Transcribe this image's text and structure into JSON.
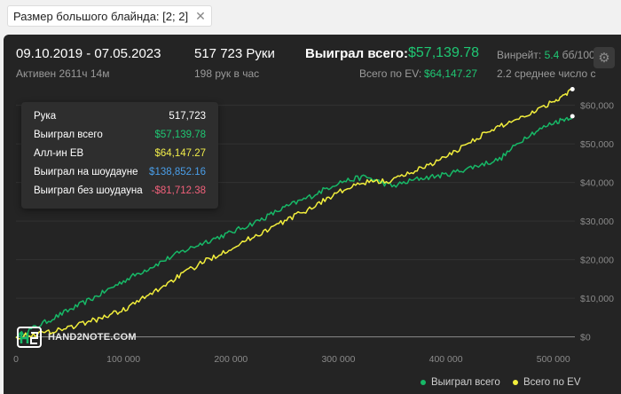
{
  "filter": {
    "label": "Размер большого блайнда: [2; 2]",
    "close_glyph": "✕"
  },
  "header": {
    "date_range": "09.10.2019 - 07.05.2023",
    "active": "Активен 2611ч 14м",
    "hands": "517 723 Руки",
    "hands_per_hour": "198 рук в час",
    "won_total_label": "Выиграл всего:",
    "won_total_value": "$57,139.78",
    "ev_label": "Всего по EV:",
    "ev_value": "$64,147.27",
    "winrate_label": "Винрейт:",
    "winrate_value": "5.4",
    "winrate_unit": "бб/100",
    "avg_text": "2.2 среднее число с"
  },
  "tooltip": {
    "rows": [
      {
        "label": "Рука",
        "value": "517,723",
        "color": "#ffffff"
      },
      {
        "label": "Выиграл всего",
        "value": "$57,139.78",
        "color": "#1fc773"
      },
      {
        "label": "Алл-ин ЕВ",
        "value": "$64,147.27",
        "color": "#f0ec4a"
      },
      {
        "label": "Выиграл на шоудауне",
        "value": "$138,852.16",
        "color": "#4a9ee8"
      },
      {
        "label": "Выиграл без шоудауна",
        "value": "-$81,712.38",
        "color": "#f0607a"
      }
    ]
  },
  "logo": {
    "text": "HAND2NOTE.COM"
  },
  "colors": {
    "won": "#17b867",
    "ev": "#f2ee3c",
    "grid": "#323232",
    "panel": "#242424"
  },
  "chart_data": {
    "type": "line",
    "x_ticks": [
      0,
      100000,
      200000,
      300000,
      400000,
      500000
    ],
    "x_tick_labels": [
      "0",
      "100 000",
      "200 000",
      "300 000",
      "400 000",
      "500 000"
    ],
    "y_ticks": [
      0,
      10000,
      20000,
      30000,
      40000,
      50000,
      60000
    ],
    "y_tick_labels": [
      "$0",
      "$10,000",
      "$20,000",
      "$30,000",
      "$40,000",
      "$50,000",
      "$60,000"
    ],
    "xlim": [
      0,
      520000
    ],
    "ylim": [
      -1000,
      64500
    ],
    "grid": true,
    "legend_position": "bottom-right",
    "series": [
      {
        "name": "Выиграл всего",
        "color": "#17b867",
        "x": [
          0,
          25000,
          50000,
          75000,
          100000,
          125000,
          150000,
          175000,
          200000,
          225000,
          250000,
          275000,
          300000,
          325000,
          350000,
          375000,
          400000,
          425000,
          450000,
          475000,
          500000,
          517723
        ],
        "y": [
          0,
          3500,
          7000,
          10500,
          14500,
          18000,
          21500,
          24500,
          27000,
          30000,
          33500,
          36500,
          40000,
          41500,
          39000,
          41000,
          42000,
          44000,
          46000,
          52000,
          55500,
          57140
        ]
      },
      {
        "name": "Всего по EV",
        "color": "#f2ee3c",
        "x": [
          0,
          25000,
          50000,
          75000,
          100000,
          125000,
          150000,
          175000,
          200000,
          225000,
          250000,
          275000,
          300000,
          325000,
          350000,
          375000,
          400000,
          425000,
          450000,
          475000,
          500000,
          517723
        ],
        "y": [
          0,
          1000,
          2500,
          4500,
          7000,
          11000,
          15500,
          19500,
          23000,
          26500,
          30000,
          33500,
          37500,
          40000,
          40500,
          43500,
          46500,
          51000,
          54500,
          57500,
          61000,
          64147
        ]
      }
    ]
  }
}
